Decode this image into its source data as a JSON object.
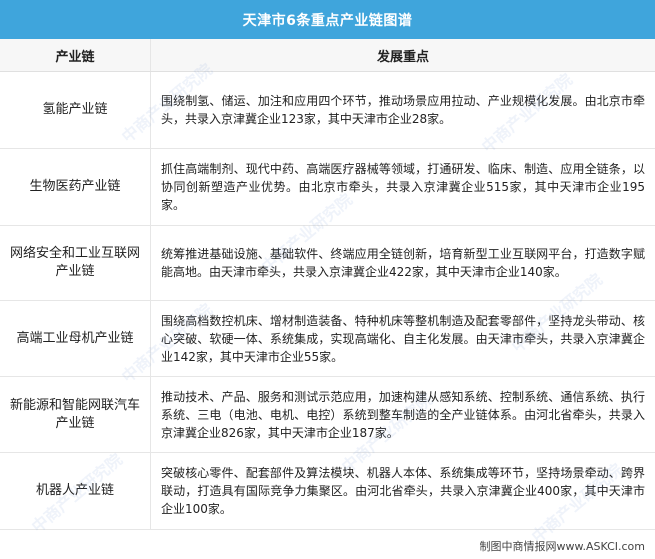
{
  "title": "天津市6条重点产业链图谱",
  "headers": {
    "chain": "产业链",
    "focus": "发展重点"
  },
  "rows": [
    {
      "chain": "氢能产业链",
      "focus": "围绕制氢、储运、加注和应用四个环节，推动场景应用拉动、产业规模化发展。由北京市牵头，共录入京津冀企业123家，其中天津市企业28家。"
    },
    {
      "chain": "生物医药产业链",
      "focus": "抓住高端制剂、现代中药、高端医疗器械等领域，打通研发、临床、制造、应用全链条，以协同创新塑造产业优势。由北京市牵头，共录入京津冀企业515家，其中天津市企业195家。"
    },
    {
      "chain": "网络安全和工业互联网产业链",
      "focus": "统筹推进基础设施、基础软件、终端应用全链创新，培育新型工业互联网平台，打造数字赋能高地。由天津市牵头，共录入京津冀企业422家，其中天津市企业140家。"
    },
    {
      "chain": "高端工业母机产业链",
      "focus": "围绕高档数控机床、增材制造装备、特种机床等整机制造及配套零部件，坚持龙头带动、核心突破、软硬一体、系统集成，实现高端化、自主化发展。由天津市牵头，共录入京津冀企业142家，其中天津市企业55家。"
    },
    {
      "chain": "新能源和智能网联汽车产业链",
      "focus": "推动技术、产品、服务和测试示范应用，加速构建从感知系统、控制系统、通信系统、执行系统、三电（电池、电机、电控）系统到整车制造的全产业链体系。由河北省牵头，共录入京津冀企业826家，其中天津市企业187家。"
    },
    {
      "chain": "机器人产业链",
      "focus": "突破核心零件、配套部件及算法模块、机器人本体、系统集成等环节，坚持场景牵动、跨界联动，打造具有国际竞争力集聚区。由河北省牵头，共录入京津冀企业400家，其中天津市企业100家。"
    }
  ],
  "footer": "制图中商情报网www.ASKCI.com",
  "watermark": "中商产业研究院",
  "colors": {
    "title_bg": "#3fa5dc",
    "header_bg": "#f7f7f7"
  }
}
